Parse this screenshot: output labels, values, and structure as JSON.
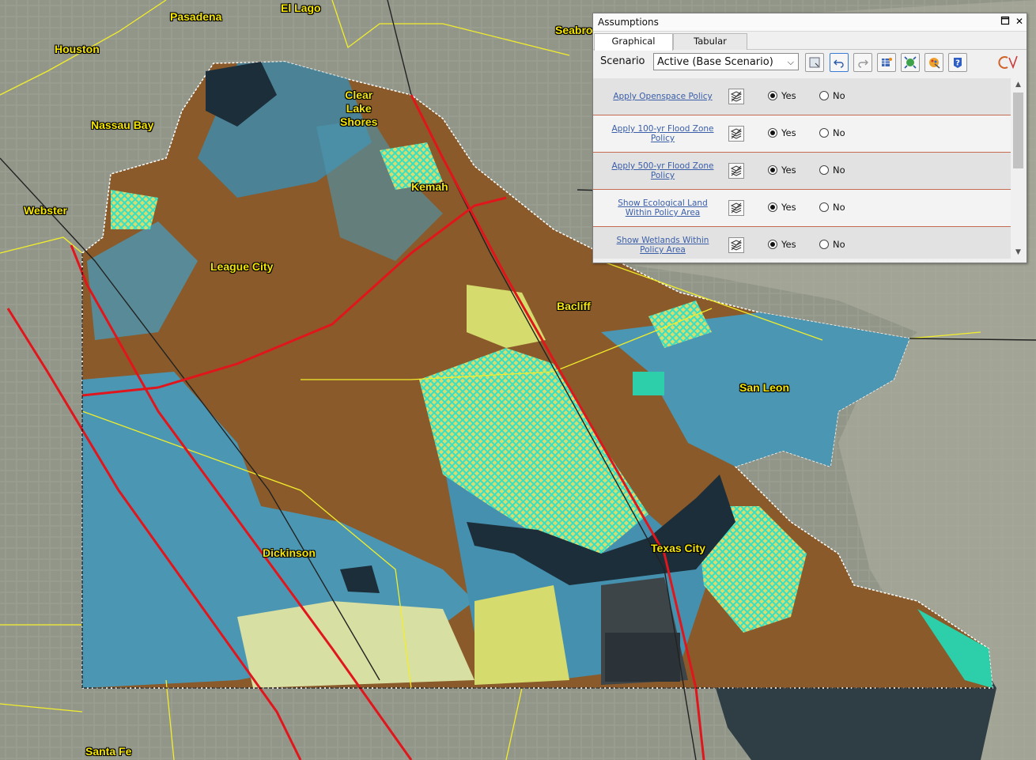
{
  "map": {
    "place_labels": [
      {
        "id": "pasadena",
        "text": "Pasadena"
      },
      {
        "id": "el-lago",
        "text": "El Lago"
      },
      {
        "id": "seabrook",
        "text": "Seabro"
      },
      {
        "id": "houston",
        "text": "Houston"
      },
      {
        "id": "clear-lake-shores",
        "text": "Clear\nLake\nShores"
      },
      {
        "id": "nassau-bay",
        "text": "Nassau Bay"
      },
      {
        "id": "kemah",
        "text": "Kemah"
      },
      {
        "id": "webster",
        "text": "Webster"
      },
      {
        "id": "league-city",
        "text": "League City"
      },
      {
        "id": "bacliff",
        "text": "Bacliff"
      },
      {
        "id": "san-leon",
        "text": "San Leon"
      },
      {
        "id": "dickinson",
        "text": "Dickinson"
      },
      {
        "id": "texas-city",
        "text": "Texas City"
      },
      {
        "id": "santa-fe",
        "text": "Santa Fe"
      }
    ],
    "colors": {
      "aerial": "#8e9486",
      "water": "#1c2e39",
      "developed_brown": "#8a5a2a",
      "blue": "#4b97b3",
      "yellow": "#d5dc6d",
      "cyan_hatch": "#35e0c5",
      "highway": "#e0161c",
      "boundary": "#f2ee2a"
    }
  },
  "panel": {
    "title": "Assumptions",
    "tabs": [
      {
        "label": "Graphical",
        "active": true
      },
      {
        "label": "Tabular",
        "active": false
      }
    ],
    "scenario_label": "Scenario",
    "scenario_value": "Active (Base Scenario)",
    "toolbar_icons": [
      "save-icon",
      "undo-icon",
      "redo-icon",
      "table-icon",
      "zoom-extent-icon",
      "paint-icon",
      "help-icon",
      "logo-icon"
    ],
    "rows": [
      {
        "label": "Apply Openspace Policy",
        "value": "Yes"
      },
      {
        "label": "Apply 100-yr Flood Zone\nPolicy",
        "value": "Yes"
      },
      {
        "label": "Apply 500-yr Flood Zone\nPolicy",
        "value": "Yes"
      },
      {
        "label": "Show Ecological Land\nWithin Policy Area",
        "value": "Yes"
      },
      {
        "label": "Show Wetlands Within\nPolicy Area",
        "value": "Yes"
      }
    ],
    "yes_label": "Yes",
    "no_label": "No"
  }
}
